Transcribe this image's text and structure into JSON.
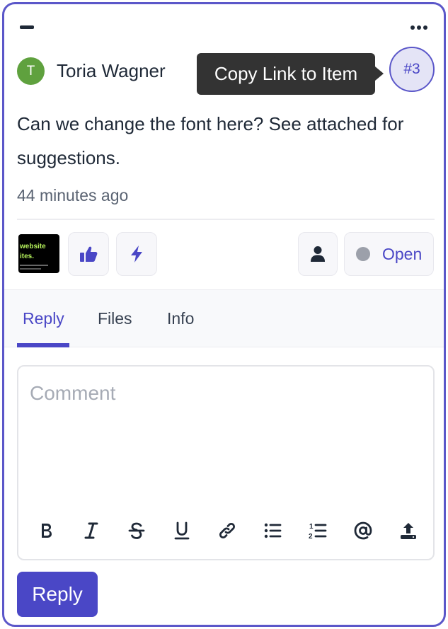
{
  "comment": {
    "author": "Toria Wagner",
    "avatar_initial": "T",
    "avatar_color": "#5fa13e",
    "body": "Can we change the font here? See attached for suggestions.",
    "timestamp": "44 minutes ago",
    "item_number": "#3",
    "tooltip": "Copy Link to Item"
  },
  "attachment": {
    "thumb_line1": "website",
    "thumb_line2": "ites."
  },
  "status": {
    "label": "Open",
    "dot_color": "#9ca0aa"
  },
  "tabs": [
    {
      "label": "Reply",
      "active": true
    },
    {
      "label": "Files",
      "active": false
    },
    {
      "label": "Info",
      "active": false
    }
  ],
  "editor": {
    "placeholder": "Comment",
    "value": ""
  },
  "toolbar_icons": [
    "bold-icon",
    "italic-icon",
    "strikethrough-icon",
    "underline-icon",
    "link-icon",
    "bullet-list-icon",
    "numbered-list-icon",
    "mention-icon",
    "upload-icon"
  ],
  "reply_button": "Reply",
  "colors": {
    "accent": "#4a47c6",
    "card_border": "#5b57c9",
    "tooltip_bg": "#333333"
  }
}
